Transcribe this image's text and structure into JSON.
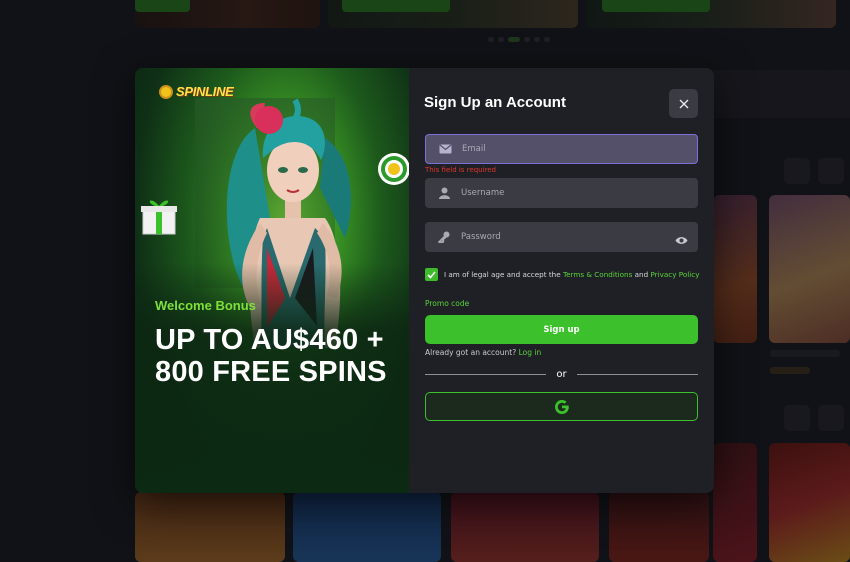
{
  "brand": {
    "logo_text": "SPINLINE"
  },
  "promo": {
    "welcome_label": "Welcome Bonus",
    "headline": "UP TO AU$460 + 800 FREE SPINS"
  },
  "signup_form": {
    "title": "Sign Up an Account",
    "email": {
      "placeholder": "Email",
      "value": "",
      "error": "This field is required"
    },
    "username": {
      "placeholder": "Username",
      "value": ""
    },
    "password": {
      "placeholder": "Password",
      "value": ""
    },
    "consent": {
      "checked": true,
      "text_prefix": "I am of legal age and accept the",
      "terms_link": "Terms & Conditions",
      "conjunction": "and",
      "privacy_link": "Privacy Policy"
    },
    "promo_code_link": "Promo code",
    "submit_label": "Sign up",
    "login_prompt": "Already got an account?",
    "login_link": "Log in",
    "divider_text": "or",
    "google_icon": "google-icon"
  },
  "colors": {
    "accent_green": "#3cc02c",
    "link_green": "#5ad23a",
    "error_red": "#e0352b",
    "panel_bg": "#1f2025",
    "field_bg": "#3a3b43"
  }
}
